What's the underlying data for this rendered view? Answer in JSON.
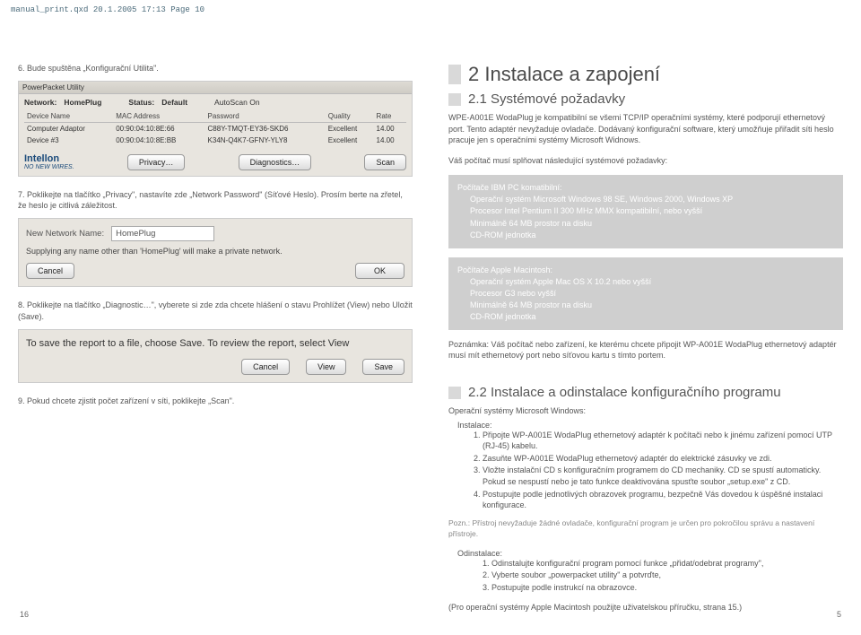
{
  "header_line": "manual_print.qxd  20.1.2005  17:13  Page 10",
  "left": {
    "step6": "6. Bude spuštěna „Konfigurační Utilita\".",
    "screenshot1": {
      "titlebar": "PowerPacket Utility",
      "network_label": "Network:",
      "network_value": "HomePlug",
      "status_label": "Status:",
      "status_value": "Default",
      "autoscan_label": "AutoScan On",
      "cols": [
        "Device Name",
        "MAC Address",
        "Password",
        "Quality",
        "Rate"
      ],
      "rows": [
        [
          "Computer Adaptor",
          "00:90:04:10:8E:66",
          "C88Y-TMQT-EY36-SKD6",
          "Excellent",
          "14.00"
        ],
        [
          "Device #3",
          "00:90:04:10:8E:BB",
          "K34N-Q4K7-GFNY-YLY8",
          "Excellent",
          "14.00"
        ]
      ],
      "logo": "Intellon",
      "logo_sub": "NO NEW WIRES.",
      "btn_privacy": "Privacy…",
      "btn_diag": "Diagnostics…",
      "btn_scan": "Scan"
    },
    "step7": "7. Poklikejte na tlačítko „Privacy\", nastavíte zde „Network Password\" (Síťové Heslo). Prosím berte na zřetel, že heslo je citlivá záležitost.",
    "dialog1": {
      "name_label": "New Network Name:",
      "name_value": "HomePlug",
      "desc": "Supplying any name other than 'HomePlug' will make a private network.",
      "btn_cancel": "Cancel",
      "btn_ok": "OK"
    },
    "step8": "8. Poklikejte na tlačítko „Diagnostic…\", vyberete si zde zda chcete hlášení o stavu Prohlížet (View) nebo Uložit (Save).",
    "dialog2": {
      "desc": "To save the report to a file, choose Save. To review the report, select View",
      "btn_cancel": "Cancel",
      "btn_view": "View",
      "btn_save": "Save"
    },
    "step9": "9. Pokud chcete zjistit počet zařízení v síti, poklikejte „Scan\"."
  },
  "right": {
    "title": "2 Instalace a zapojení",
    "sub21": "2.1 Systémové požadavky",
    "p1": "WPE-A001E WodaPlug je kompatibilní se všemi TCP/IP operačními systémy, které podporují ethernetový port. Tento adaptér nevyžaduje ovladače. Dodávaný konfigurační software, který umožňuje přiřadit síti heslo pracuje jen s operačními systémy Microsoft Widnows.",
    "p2": "Váš počítač musí splňovat následující systémové požadavky:",
    "req_pc": {
      "head": "Počítače IBM PC komatibilní:",
      "l1": "Operační systém Microsoft Windows 98 SE, Windows 2000, Windows XP",
      "l2": "Procesor Intel Pentium II 300 MHz MMX kompatibilní, nebo vyšší",
      "l3": "Minimálně 64 MB prostor na disku",
      "l4": "CD-ROM jednotka"
    },
    "req_mac": {
      "head": "Počítače Apple Macintosh:",
      "l1": "Operační systém Apple Mac OS X 10.2 nebo vyšší",
      "l2": "Procesor G3 nebo vyšší",
      "l3": "Minimálně 64 MB prostor na disku",
      "l4": "CD-ROM jednotka"
    },
    "note": "Poznámka: Váš počítač nebo zařízení, ke kterému chcete připojit WP-A001E WodaPlug ethernetový adaptér musí mít ethernetový port nebo síťovou kartu s tímto portem.",
    "sub22": "2.2 Instalace a odinstalace konfiguračního programu",
    "install_label": "Operační systémy Microsoft Windows:",
    "install_sub": "Instalace:",
    "install_steps": {
      "s1": "Připojte WP-A001E WodaPlug ethernetový adaptér k počítači nebo k jinému zařízení pomocí UTP (RJ-45) kabelu.",
      "s2": "Zasuňte WP-A001E WodaPlug ethernetový adaptér do elektrické zásuvky ve zdi.",
      "s3": "Vložte instalační CD s konfiguračním programem do CD mechaniky. CD se spustí automaticky. Pokud se nespustí nebo je tato funkce deaktivována spusťte soubor „setup.exe\" z CD.",
      "s4": "Postupujte podle jednotlivých obrazovek programu, bezpečně Vás dovedou k úspěšné instalaci konfigurace."
    },
    "note2": "Pozn.: Přístroj nevyžaduje žádné ovladače, konfigurační program je určen pro pokročilou správu a nastavení přístroje.",
    "uninstall_sub": "Odinstalace:",
    "uninstall_steps": {
      "s1": "Odinstalujte konfigurační program pomocí funkce „přidat/odebrat programy\",",
      "s2": "Vyberte soubor „powerpacket utility\" a potvrďte,",
      "s3": "Postupujte podle instrukcí na obrazovce."
    },
    "footnote": "(Pro operační systémy Apple Macintosh použijte uživatelskou příručku, strana 15.)"
  },
  "page_left": "16",
  "page_right": "5"
}
